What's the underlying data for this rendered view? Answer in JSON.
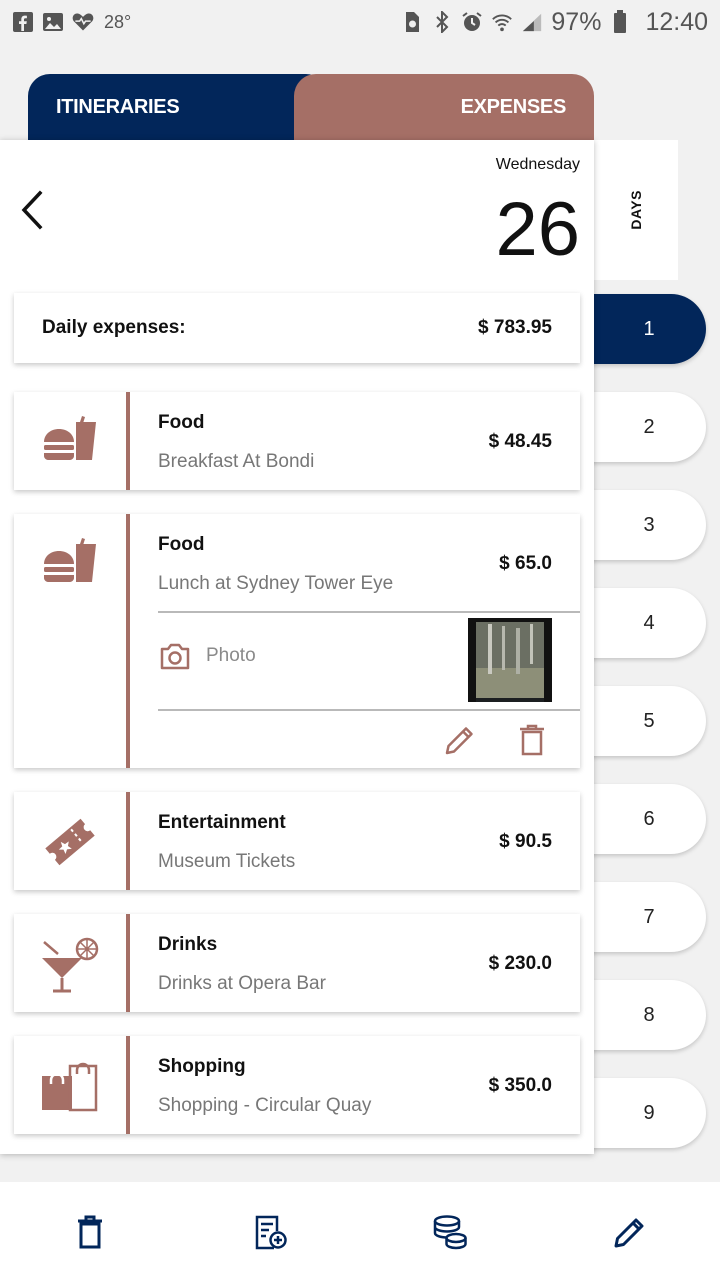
{
  "status_bar": {
    "temperature": "28°",
    "battery": "97%",
    "time": "12:40",
    "icons_left": [
      "facebook-icon",
      "gallery-icon",
      "health-icon"
    ],
    "icons_right": [
      "sim-icon",
      "bluetooth-icon",
      "alarm-icon",
      "wifi-icon",
      "signal-icon",
      "battery-icon"
    ]
  },
  "tabs": {
    "itineraries": "ITINERARIES",
    "expenses": "EXPENSES"
  },
  "header": {
    "weekday": "Wednesday",
    "day_number": "26"
  },
  "days_rail": {
    "label": "DAYS",
    "days": [
      "1",
      "2",
      "3",
      "4",
      "5",
      "6",
      "7",
      "8",
      "9"
    ],
    "selected": "1"
  },
  "daily_expenses": {
    "label": "Daily expenses:",
    "total": "$ 783.95"
  },
  "expenses": [
    {
      "category": "Food",
      "description": "Breakfast At Bondi",
      "amount": "$ 48.45",
      "icon": "food-icon"
    },
    {
      "category": "Food",
      "description": "Lunch at Sydney Tower Eye",
      "amount": "$ 65.0",
      "icon": "food-icon",
      "photo_label": "Photo",
      "expanded": true
    },
    {
      "category": "Entertainment",
      "description": "Museum Tickets",
      "amount": "$ 90.5",
      "icon": "ticket-icon"
    },
    {
      "category": "Drinks",
      "description": "Drinks at Opera Bar",
      "amount": "$ 230.0",
      "icon": "cocktail-icon"
    },
    {
      "category": "Shopping",
      "description": "Shopping - Circular Quay",
      "amount": "$ 350.0",
      "icon": "shopping-bags-icon"
    }
  ],
  "bottom_bar": [
    "trash-icon",
    "add-item-icon",
    "coins-icon",
    "edit-icon"
  ],
  "colors": {
    "navy": "#02265a",
    "accent": "#a56f66",
    "background": "#f1f1f1"
  }
}
